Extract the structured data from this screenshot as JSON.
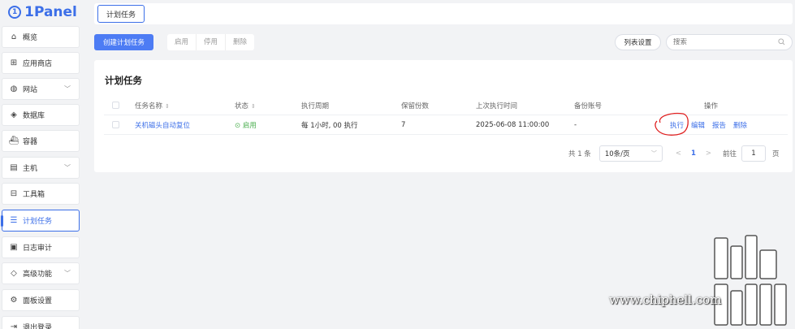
{
  "app": {
    "logo_text": "1Panel"
  },
  "sidebar": {
    "items": [
      {
        "label": "概览",
        "icon": "home-icon"
      },
      {
        "label": "应用商店",
        "icon": "apps-icon"
      },
      {
        "label": "网站",
        "icon": "globe-icon",
        "expandable": true
      },
      {
        "label": "数据库",
        "icon": "database-icon"
      },
      {
        "label": "容器",
        "icon": "container-icon"
      },
      {
        "label": "主机",
        "icon": "host-icon",
        "expandable": true
      },
      {
        "label": "工具箱",
        "icon": "toolbox-icon"
      },
      {
        "label": "计划任务",
        "icon": "cron-icon",
        "active": true
      },
      {
        "label": "日志审计",
        "icon": "log-icon"
      },
      {
        "label": "高级功能",
        "icon": "diamond-icon",
        "expandable": true
      },
      {
        "label": "面板设置",
        "icon": "gear-icon"
      },
      {
        "label": "退出登录",
        "icon": "logout-icon"
      }
    ]
  },
  "tabs": {
    "current": "计划任务"
  },
  "toolbar": {
    "create_label": "创建计划任务",
    "enable_label": "启用",
    "disable_label": "停用",
    "delete_label": "删除",
    "columns_label": "列表设置",
    "search_placeholder": "搜索"
  },
  "card": {
    "title": "计划任务",
    "columns": {
      "name": "任务名称",
      "status": "状态",
      "period": "执行周期",
      "retain": "保留份数",
      "last_run": "上次执行时间",
      "backup": "备份账号",
      "ops": "操作"
    },
    "rows": [
      {
        "name": "关机磁头自动复位",
        "status": "启用",
        "period": "每 1小时, 00 执行",
        "retain": "7",
        "last_run": "2025-06-08 11:00:00",
        "backup": "-",
        "actions": {
          "run": "执行",
          "edit": "编辑",
          "report": "报告",
          "delete": "删除"
        }
      }
    ]
  },
  "pagination": {
    "total": "共 1 条",
    "page_size": "10条/页",
    "prev": "<",
    "current_page": "1",
    "next": ">",
    "goto_label": "前往",
    "goto_value": "1",
    "page_suffix": "页"
  },
  "watermark": {
    "text": "www.chiphell.com"
  },
  "colors": {
    "accent": "#3c6fe8",
    "status_ok": "#4caf50",
    "annotation": "#e02020"
  }
}
